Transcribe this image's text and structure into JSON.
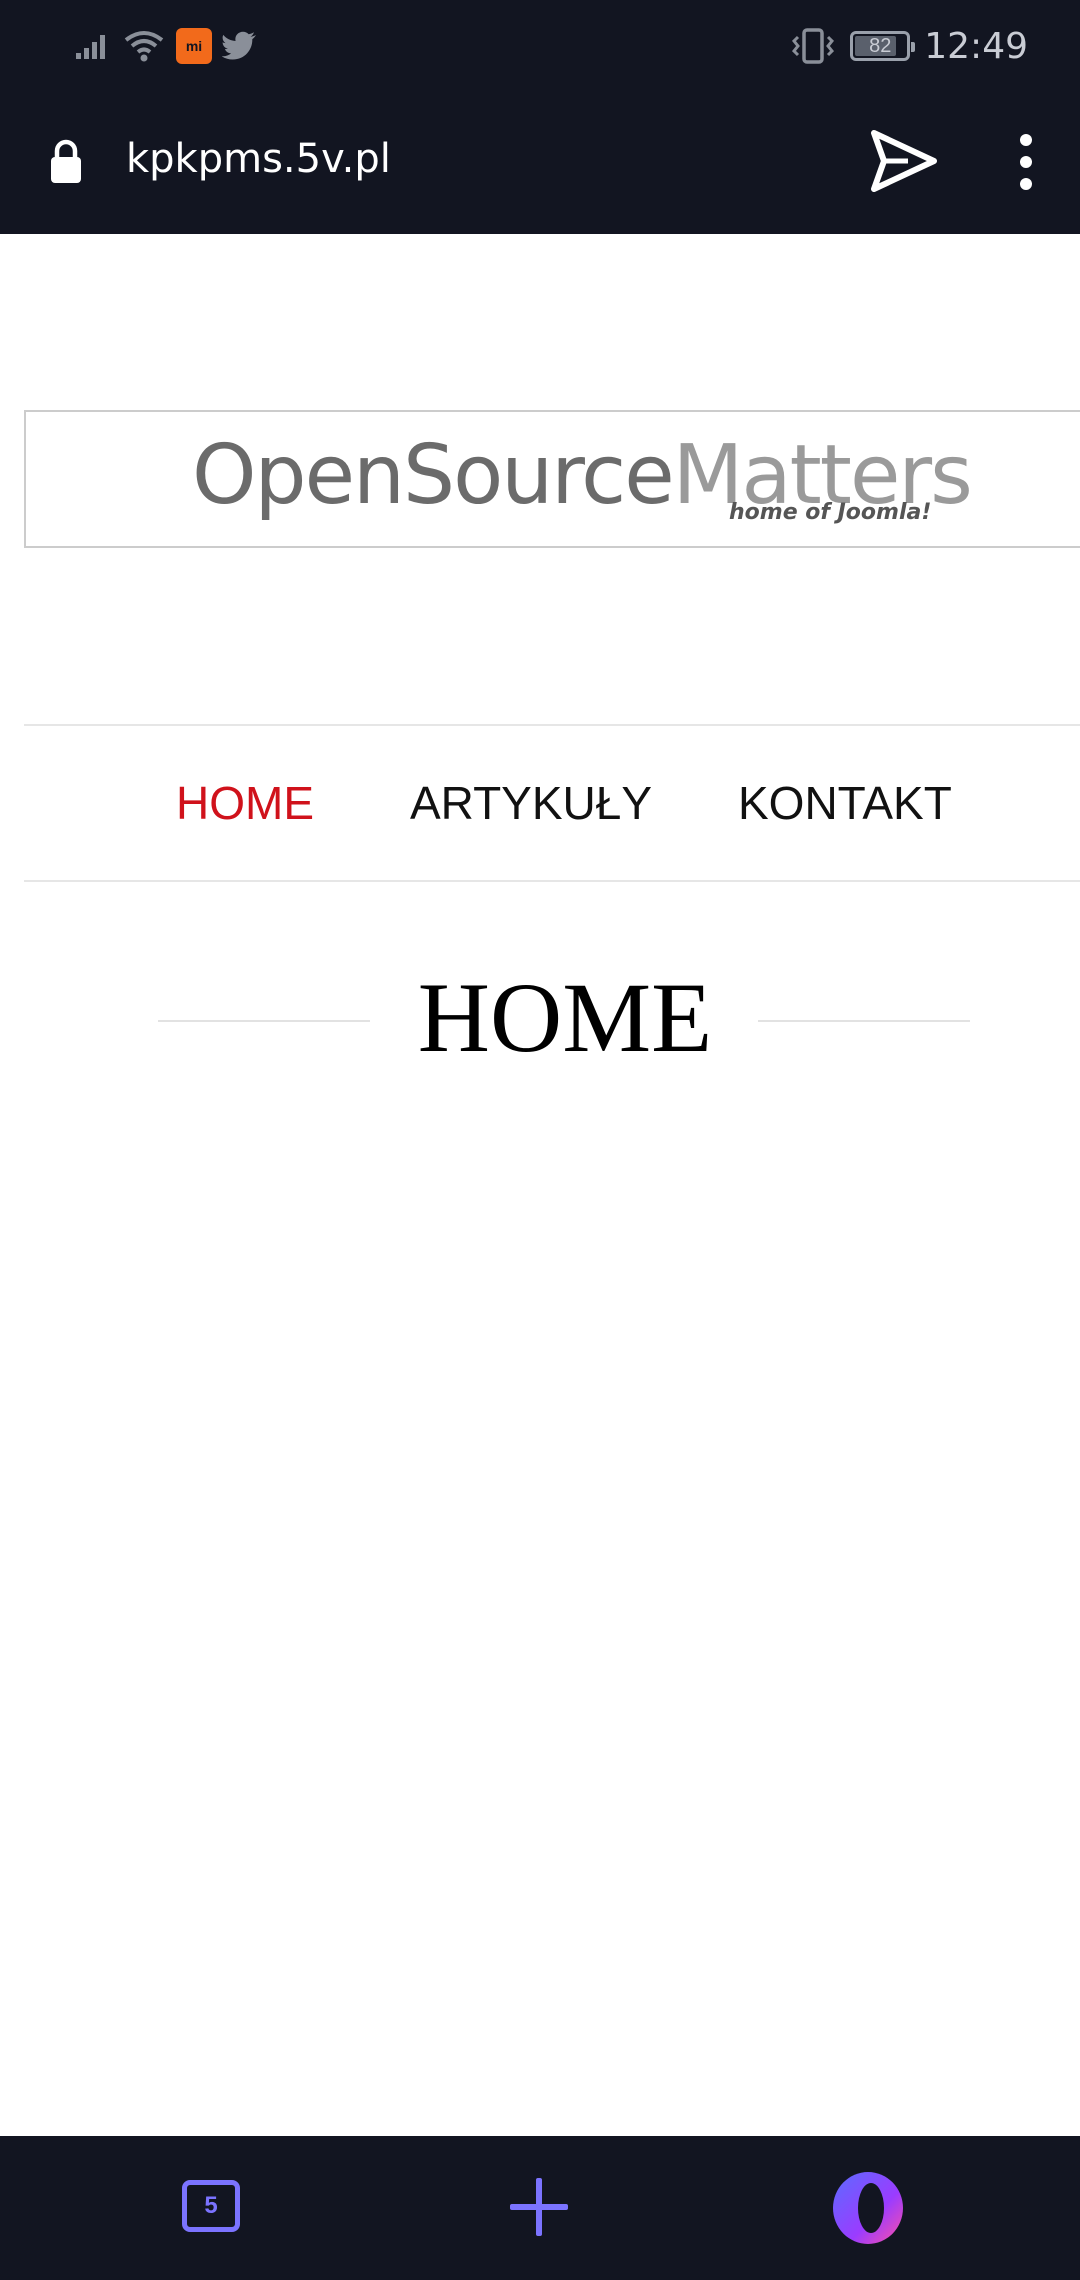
{
  "status_bar": {
    "time": "12:49",
    "battery_percent": "82",
    "icons": [
      "signal-icon",
      "wifi-icon",
      "mi-app-icon",
      "twitter-icon",
      "vibrate-icon",
      "battery-icon"
    ],
    "mi_label": "mi"
  },
  "address_bar": {
    "url": "kpkpms.5v.pl",
    "icons": [
      "lock-icon",
      "send-icon",
      "menu-icon"
    ]
  },
  "logo": {
    "main_dark": "OpenSource",
    "main_light": "Matters",
    "sub": "home of Joomla!"
  },
  "nav": {
    "items": [
      {
        "label": "HOME",
        "active": true
      },
      {
        "label": "ARTYKUŁY",
        "active": false
      },
      {
        "label": "KONTAKT",
        "active": false
      }
    ]
  },
  "page": {
    "heading": "HOME"
  },
  "bottom_bar": {
    "tab_count": "5",
    "icons": [
      "tabs-icon",
      "plus-icon",
      "opera-icon"
    ]
  },
  "colors": {
    "bar_bg": "#121521",
    "active_nav": "#d0121b",
    "accent": "#7b73ff"
  }
}
